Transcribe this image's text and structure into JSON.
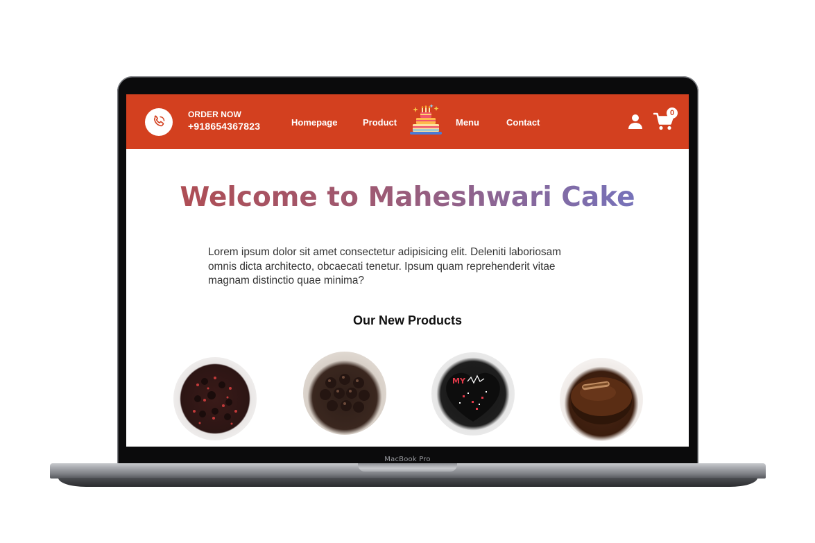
{
  "device": {
    "label": "MacBook Pro"
  },
  "navbar": {
    "order_label": "ORDER NOW",
    "phone_number": "+918654367823",
    "links": [
      {
        "label": "Homepage"
      },
      {
        "label": "Product"
      },
      {
        "label": "Menu"
      },
      {
        "label": "Contact"
      }
    ],
    "logo_icon": "cake-icon",
    "cart_count": "0",
    "icons": [
      "phone-icon",
      "user-icon",
      "cart-icon"
    ],
    "colors": {
      "background": "#d3401f",
      "text": "#ffffff"
    }
  },
  "hero": {
    "title": "Welcome to Maheshwari Cake",
    "description": "Lorem ipsum dolor sit amet consectetur adipisicing elit. Deleniti laboriosam omnis dicta architecto, obcaecati tenetur. Ipsum quam reprehenderit vitae magnam distinctio quae minima?",
    "title_gradient": [
      "#b34a4c",
      "#6e77c8"
    ]
  },
  "products": {
    "title": "Our New Products",
    "items": [
      {
        "image": "chocolate-sprinkle-cake"
      },
      {
        "image": "chocolate-ball-cake"
      },
      {
        "image": "heart-shaped-black-cake",
        "text": "MY"
      },
      {
        "image": "chocolate-truffle-cake"
      }
    ]
  }
}
